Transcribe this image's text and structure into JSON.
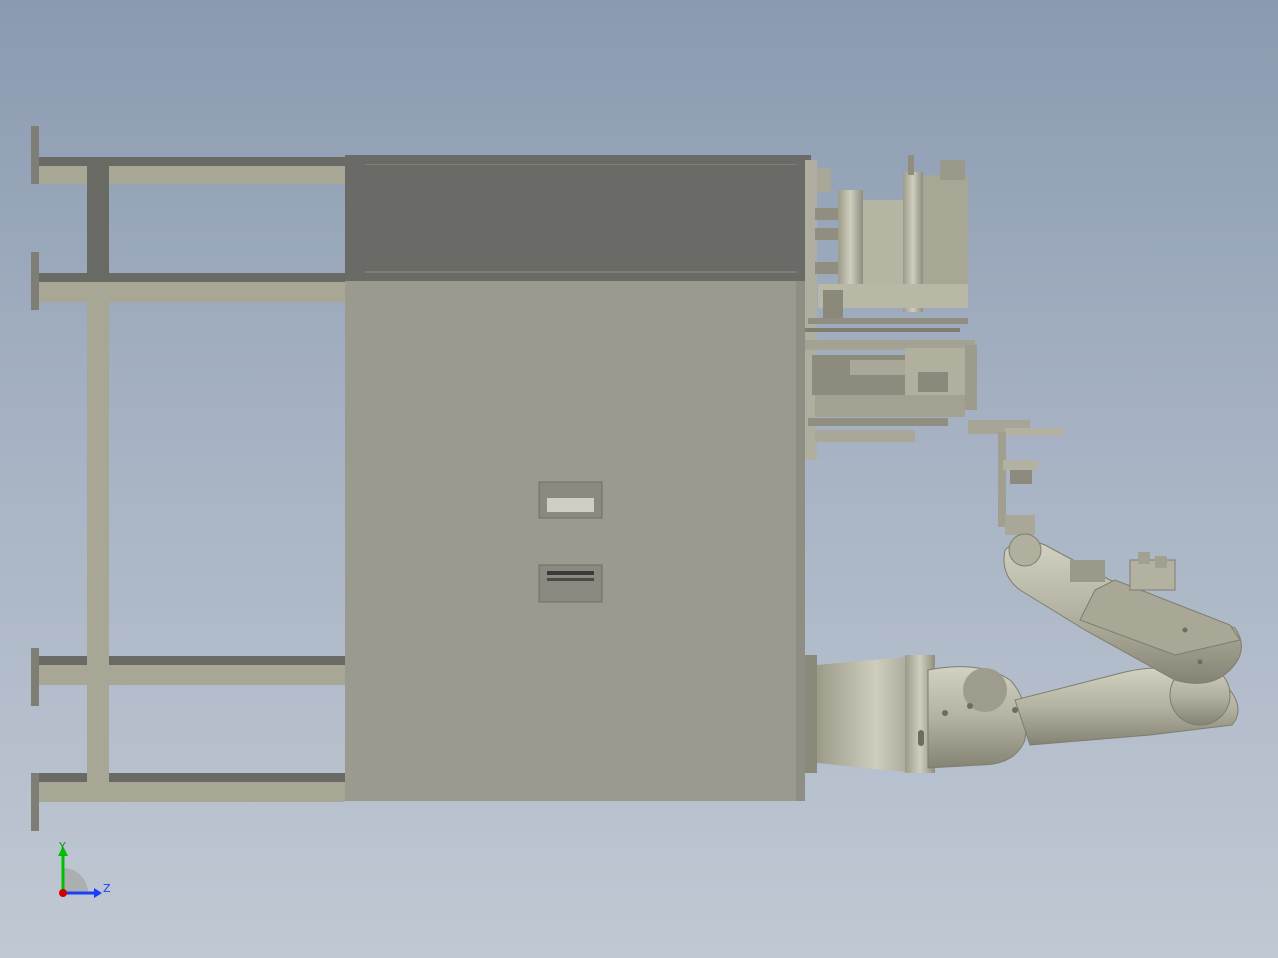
{
  "viewport": {
    "background_top": "#8a9ab0",
    "background_bottom": "#c0c8d3",
    "model_colors": {
      "frame_light": "#a8a795",
      "frame_dark": "#6a6a64",
      "panel": "#9a9a8e",
      "robot": "#b8b7a6",
      "robot_shadow": "#8a897a"
    }
  },
  "triad": {
    "y_axis_label": "Y",
    "z_axis_label": "Z",
    "y_color": "#00c000",
    "z_color": "#1a3cff",
    "origin_color": "#d00000"
  }
}
